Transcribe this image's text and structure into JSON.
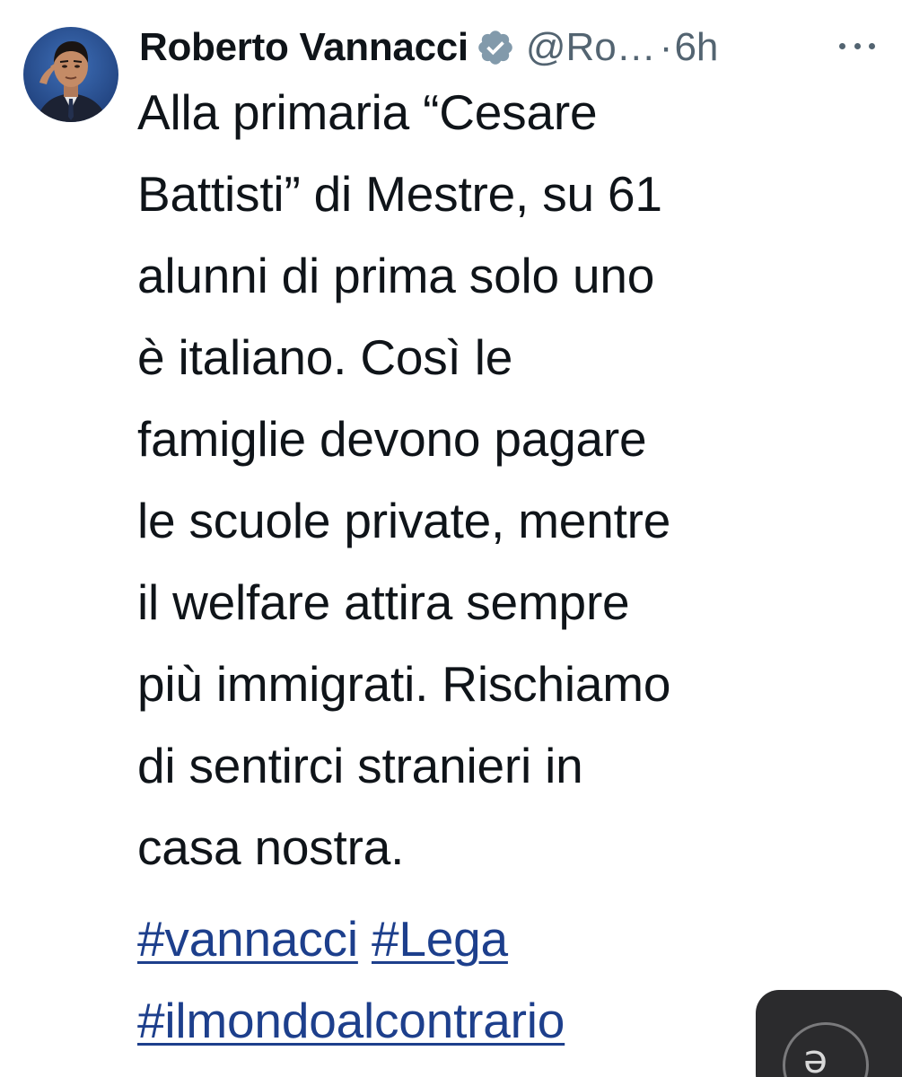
{
  "tweet": {
    "author": {
      "name": "Roberto Vannacci",
      "handle": "@Ro…",
      "verified": true
    },
    "separator": "·",
    "time": "6h",
    "text_lines": [
      "Alla primaria “Cesare",
      "Battisti” di Mestre, su 61",
      "alunni di prima solo uno",
      "è italiano. Così le",
      "famiglie devono pagare",
      "le scuole private, mentre",
      "il welfare attira sempre",
      "più immigrati. Rischiamo",
      "di sentirci stranieri in",
      "casa nostra."
    ],
    "hashtags": [
      "#vannacci",
      "#Lega",
      "#ilmondoalcontrario"
    ]
  },
  "floating_button": {
    "icon": "translate-icon",
    "glyph": "ə"
  },
  "colors": {
    "text": "#0f1419",
    "secondary": "#536471",
    "hashtag": "#1d3f8c",
    "verified_badge": "#829aab",
    "floating_button_bg": "#2b2b2d"
  }
}
